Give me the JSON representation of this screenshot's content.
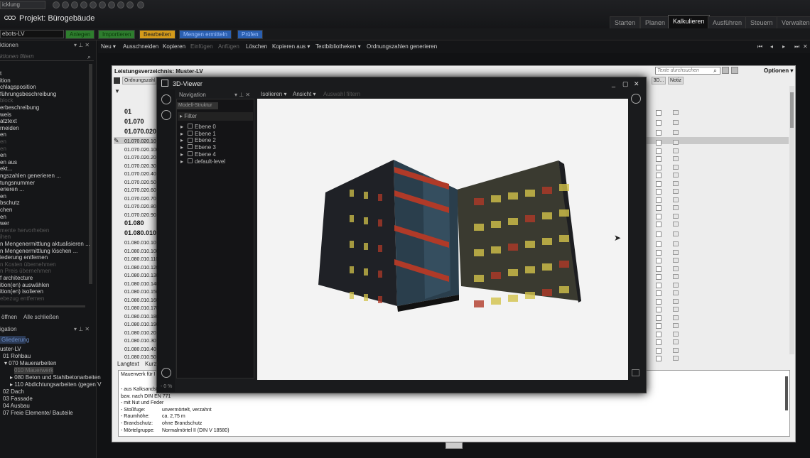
{
  "top": {
    "project_select": "icklung",
    "project_title": "Projekt: Bürogebäude",
    "main_tabs": [
      "Starten",
      "Planen",
      "Kalkulieren",
      "Ausführen",
      "Steuern",
      "Verwalten"
    ],
    "active_tab": "Kalkulieren"
  },
  "row2": {
    "lv_select": "ebots-LV",
    "modes": [
      "Anlegen",
      "Importieren",
      "Bearbeiten",
      "Mengen ermitteln",
      "Prüfen"
    ],
    "mode_colors": [
      "#2e7d2e",
      "#2e7d2e",
      "#d49a1a",
      "#2a5fb0",
      "#2a5fb0"
    ]
  },
  "toolbar": {
    "items": [
      "Neu ▾",
      "Ausschneiden",
      "Kopieren",
      "Einfügen",
      "Anfügen",
      "Löschen",
      "Kopieren aus ▾",
      "Textbibliotheken ▾",
      "Ordnungszahlen generieren"
    ],
    "disabled": [
      false,
      false,
      false,
      true,
      true,
      false,
      false,
      false,
      false
    ],
    "nav_arrows": [
      "⏮",
      "◂",
      "▸",
      "⏭",
      "✕"
    ]
  },
  "left_panel": {
    "header": "ktionen",
    "filter_placeholder": "ktionen filtern",
    "items": [
      {
        "t": "t",
        "dim": false
      },
      {
        "t": "ition",
        "dim": false
      },
      {
        "t": "chlagsposition",
        "dim": false
      },
      {
        "t": "führungsbeschreibung",
        "dim": false
      },
      {
        "t": "block",
        "dim": true
      },
      {
        "t": "erbeschreibung",
        "dim": false
      },
      {
        "t": "weis",
        "dim": false
      },
      {
        "t": "atztext",
        "dim": false
      },
      {
        "t": "rneiden",
        "dim": false
      },
      {
        "t": "en",
        "dim": false
      },
      {
        "t": "en",
        "dim": true
      },
      {
        "t": "en",
        "dim": true
      },
      {
        "t": "en",
        "dim": false
      },
      {
        "t": "en aus",
        "dim": false
      },
      {
        "t": "ekt...",
        "dim": false
      },
      {
        "t": "ngszahlen generieren ...",
        "dim": false
      },
      {
        "t": "tungsnummer",
        "dim": false
      },
      {
        "t": "erieren ...",
        "dim": false
      },
      {
        "t": "en",
        "dim": false
      },
      {
        "t": "bschutz",
        "dim": false
      },
      {
        "t": "chen",
        "dim": false
      },
      {
        "t": "en",
        "dim": false
      },
      {
        "t": "wer",
        "dim": false
      },
      {
        "t": "mente hervorheben",
        "dim": true
      },
      {
        "t": "ihen",
        "dim": true
      },
      {
        "t": "n Mengenermittlung aktualisieren ...",
        "dim": false
      },
      {
        "t": "n Mengenermittlung löschen ...",
        "dim": false
      },
      {
        "t": "iederung entfernen",
        "dim": false
      },
      {
        "t": "n Kosten übernehmen",
        "dim": true
      },
      {
        "t": "n Preis übernehmen",
        "dim": true
      },
      {
        "t": "f architecture",
        "dim": false
      },
      {
        "t": "ition(en) auswählen",
        "dim": false
      },
      {
        "t": "ition(en) isolieren",
        "dim": false
      },
      {
        "t": "ebezug entfernen",
        "dim": true
      }
    ],
    "btn_open": "öffnen",
    "btn_close_all": "Alle schließen"
  },
  "nav_panel": {
    "header": "igation",
    "tab": "Gliederung",
    "items": [
      {
        "t": "uster-LV",
        "sel": false
      },
      {
        "t": "01 Rohbau",
        "sel": false
      },
      {
        "t": "▾ 070 Mauerarbeiten",
        "sel": false
      },
      {
        "t": "010 Mauerwerk",
        "sel": true
      },
      {
        "t": "▸ 080 Beton und Stahlbetonarbeiten",
        "sel": false
      },
      {
        "t": "▸ 110 Abdichtungsarbeiten (gegen V",
        "sel": false
      },
      {
        "t": "02 Dach",
        "sel": false
      },
      {
        "t": "03 Fassade",
        "sel": false
      },
      {
        "t": "04 Ausbau",
        "sel": false
      },
      {
        "t": "07 Freie Elemente/ Bauteile",
        "sel": false
      }
    ]
  },
  "main": {
    "title": "Leistungsverzeichnis: Muster-LV",
    "search_placeholder": "Texte durchsuchen",
    "options": "Optionen ▾",
    "col_oz": "Ordnungszahl",
    "col_3d": "3D...",
    "col_notiz": "Notiz",
    "rows": [
      {
        "oz": "01",
        "big": true
      },
      {
        "oz": "01.070",
        "big": true
      },
      {
        "oz": "01.070.020",
        "big": true
      },
      {
        "oz": "01.070.020.10",
        "big": false
      },
      {
        "oz": "01.070.020.100",
        "big": false
      },
      {
        "oz": "01.070.020.20",
        "big": false
      },
      {
        "oz": "01.070.020.30",
        "big": false
      },
      {
        "oz": "01.070.020.40",
        "big": false
      },
      {
        "oz": "01.070.020.50",
        "big": false
      },
      {
        "oz": "01.070.020.60",
        "big": false
      },
      {
        "oz": "01.070.020.70",
        "big": false
      },
      {
        "oz": "01.070.020.80",
        "big": false
      },
      {
        "oz": "01.070.020.90",
        "big": false
      },
      {
        "oz": "01.080",
        "big": true
      },
      {
        "oz": "01.080.010",
        "big": true
      },
      {
        "oz": "01.080.010.10",
        "big": false
      },
      {
        "oz": "01.080.010.100",
        "big": false
      },
      {
        "oz": "01.080.010.110",
        "big": false
      },
      {
        "oz": "01.080.010.120",
        "big": false
      },
      {
        "oz": "01.080.010.130",
        "big": false
      },
      {
        "oz": "01.080.010.140",
        "big": false
      },
      {
        "oz": "01.080.010.150",
        "big": false
      },
      {
        "oz": "01.080.010.160",
        "big": false
      },
      {
        "oz": "01.080.010.170",
        "big": false
      },
      {
        "oz": "01.080.010.180",
        "big": false
      },
      {
        "oz": "01.080.010.190",
        "big": false
      },
      {
        "oz": "01.080.010.20",
        "big": false
      },
      {
        "oz": "01.080.010.30",
        "big": false
      },
      {
        "oz": "01.080.010.40",
        "big": false
      },
      {
        "oz": "01.080.010.50",
        "big": false
      }
    ]
  },
  "bottom_text": {
    "tabs": [
      "Langtext",
      "Kurzt"
    ],
    "heading": "Mauerwerk für I",
    "lines": [
      {
        "k": "- aus Kalksandst",
        "v": ""
      },
      {
        "k": "  bzw. nach DIN EN 771",
        "v": ""
      },
      {
        "k": "- mit Nut und Feder",
        "v": ""
      },
      {
        "k": "- Stoßfuge:",
        "v": "unvermörtelt, verzahnt"
      },
      {
        "k": "- Raumhöhe:",
        "v": "ca. 2,75 m"
      },
      {
        "k": "- Brandschutz:",
        "v": "ohne Brandschutz"
      },
      {
        "k": "- Mörtelgruppe:",
        "v": "Normalmörtel II (DIN V 18580)"
      }
    ]
  },
  "viewer": {
    "title": "3D-Viewer",
    "nav_label": "Navigation",
    "tab_model": "Modell-Struktur",
    "filter": "▸ Filter",
    "levels": [
      "Ebene 0",
      "Ebene 1",
      "Ebene 2",
      "Ebene 3",
      "Ebene 4",
      "default-level"
    ],
    "tools": [
      "Isolieren ▾",
      "Ansicht ▾",
      "Auswahl filtern"
    ],
    "tools_disabled": [
      false,
      false,
      true
    ],
    "zoom": "- 0 %",
    "building_colors": {
      "wall": "#3a3a30",
      "dark": "#1f2126",
      "stair": "#2a3e4c",
      "band": "#b03a28",
      "window": "#d2c24a"
    }
  }
}
